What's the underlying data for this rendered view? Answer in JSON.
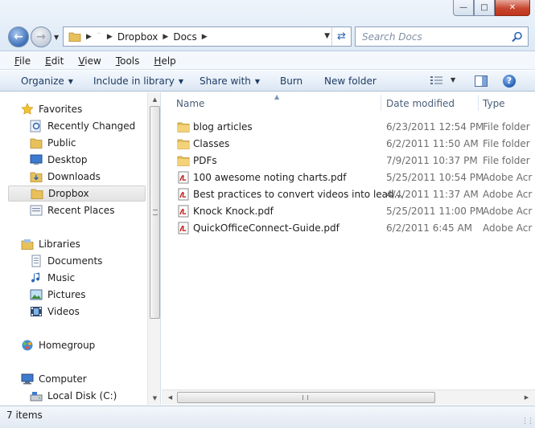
{
  "window": {
    "minimize_glyph": "—",
    "maximize_glyph": "□",
    "close_glyph": "✕"
  },
  "address": {
    "hidden_segment": "¨",
    "breadcrumbs": [
      "Dropbox",
      "Docs"
    ],
    "search_placeholder": "Search Docs"
  },
  "menu": {
    "items": [
      {
        "underline": "F",
        "rest": "ile"
      },
      {
        "underline": "E",
        "rest": "dit"
      },
      {
        "underline": "V",
        "rest": "iew"
      },
      {
        "underline": "T",
        "rest": "ools"
      },
      {
        "underline": "H",
        "rest": "elp"
      }
    ]
  },
  "toolbar": {
    "organize": "Organize",
    "include_in_library": "Include in library",
    "share_with": "Share with",
    "burn": "Burn",
    "new_folder": "New folder",
    "help_glyph": "?"
  },
  "navigation": {
    "favorites_header": "Favorites",
    "favorites": [
      "Recently Changed",
      "Public",
      "Desktop",
      "Downloads",
      "Dropbox",
      "Recent Places"
    ],
    "selected": "Dropbox",
    "libraries_header": "Libraries",
    "libraries": [
      "Documents",
      "Music",
      "Pictures",
      "Videos"
    ],
    "homegroup": "Homegroup",
    "computer_header": "Computer",
    "computer": [
      "Local Disk (C:)"
    ]
  },
  "columns": {
    "name": "Name",
    "date_modified": "Date modified",
    "type": "Type"
  },
  "files": [
    {
      "name": "blog articles",
      "date": "6/23/2011 12:54 PM",
      "type": "File folder",
      "icon": "folder-icon"
    },
    {
      "name": "Classes",
      "date": "6/2/2011 11:50 AM",
      "type": "File folder",
      "icon": "folder-icon"
    },
    {
      "name": "PDFs",
      "date": "7/9/2011 10:37 PM",
      "type": "File folder",
      "icon": "folder-icon"
    },
    {
      "name": "100 awesome noting charts.pdf",
      "date": "5/25/2011 10:54 PM",
      "type": "Adobe Acr",
      "icon": "pdf-icon"
    },
    {
      "name": "Best practices to convert videos into lead...",
      "date": "4/4/2011 11:37 AM",
      "type": "Adobe Acr",
      "icon": "pdf-icon"
    },
    {
      "name": "Knock Knock.pdf",
      "date": "5/25/2011 11:00 PM",
      "type": "Adobe Acr",
      "icon": "pdf-icon"
    },
    {
      "name": "QuickOfficeConnect-Guide.pdf",
      "date": "6/2/2011 6:45 AM",
      "type": "Adobe Acr",
      "icon": "pdf-icon"
    }
  ],
  "status": {
    "item_count": "7 items"
  },
  "colors": {
    "accent": "#2a63b5",
    "folder": "#e8c15a",
    "pdf_red": "#c0201b"
  }
}
